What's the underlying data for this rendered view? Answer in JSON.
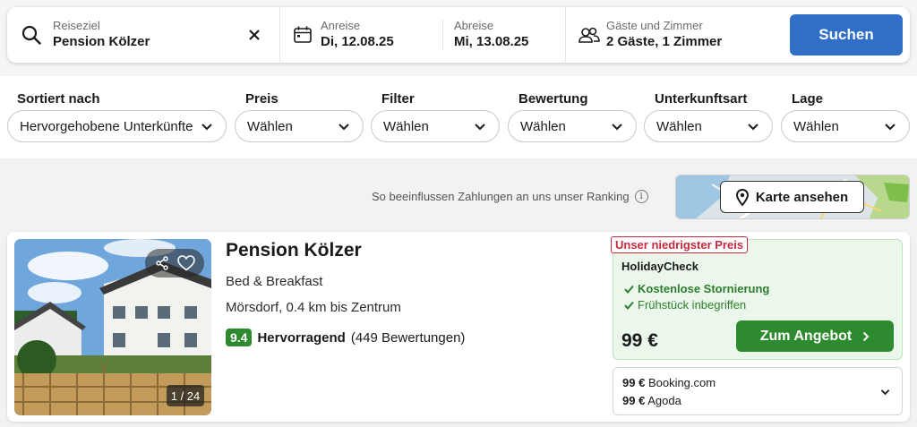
{
  "search": {
    "destination_label": "Reiseziel",
    "destination_value": "Pension Kölzer",
    "clear_icon": "close-icon",
    "checkin_label": "Anreise",
    "checkin_value": "Di, 12.08.25",
    "checkout_label": "Abreise",
    "checkout_value": "Mi, 13.08.25",
    "guests_label": "Gäste und Zimmer",
    "guests_value": "2 Gäste, 1 Zimmer",
    "search_button": "Suchen"
  },
  "filters": [
    {
      "label": "Sortiert nach",
      "value": "Hervorgehobene Unterkünfte"
    },
    {
      "label": "Preis",
      "value": "Wählen"
    },
    {
      "label": "Filter",
      "value": "Wählen"
    },
    {
      "label": "Bewertung",
      "value": "Wählen"
    },
    {
      "label": "Unterkunftsart",
      "value": "Wählen"
    },
    {
      "label": "Lage",
      "value": "Wählen"
    }
  ],
  "ranking_note": "So beeinflussen Zahlungen an uns unser Ranking",
  "map_button": "Karte ansehen",
  "hotel": {
    "name": "Pension Kölzer",
    "type": "Bed & Breakfast",
    "location": "Mörsdorf, 0.4 km bis Zentrum",
    "score": "9.4",
    "rating_label": "Hervorragend",
    "reviews": "(449 Bewertungen)",
    "photo_counter": "1 / 24",
    "best_offer": {
      "badge": "Unser niedrigster Preis",
      "provider": "HolidayCheck",
      "features": [
        "Kostenlose Stornierung",
        "Frühstück inbegriffen"
      ],
      "price": "99 €",
      "button": "Zum Angebot"
    },
    "other_offers": [
      {
        "price": "99 €",
        "provider": "Booking.com"
      },
      {
        "price": "99 €",
        "provider": "Agoda"
      }
    ]
  },
  "colors": {
    "primary_blue": "#2f6fc8",
    "deal_green": "#2e8a2e",
    "badge_red": "#c8283c"
  }
}
